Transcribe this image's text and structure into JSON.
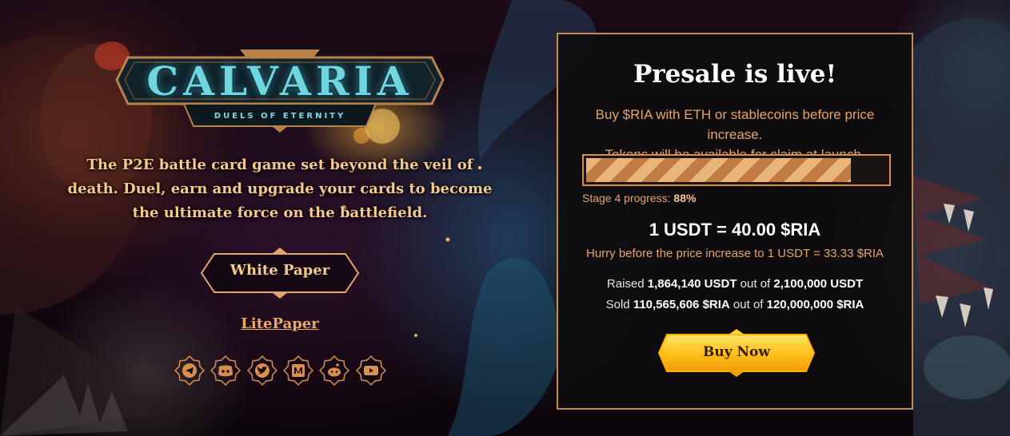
{
  "logo": {
    "title": "CALVARIA",
    "subtitle": "DUELS OF ETERNITY"
  },
  "hero": {
    "tagline": "The P2E battle card game set beyond the veil of death. Duel, earn and upgrade your cards to become the ultimate force on the battlefield.",
    "white_paper_label": "White Paper",
    "litepaper_label": "LitePaper"
  },
  "socials": [
    {
      "icon": "telegram-icon"
    },
    {
      "icon": "discord-icon"
    },
    {
      "icon": "twitter-icon"
    },
    {
      "icon": "medium-icon"
    },
    {
      "icon": "reddit-icon"
    },
    {
      "icon": "youtube-icon"
    }
  ],
  "presale": {
    "title": "Presale is live!",
    "desc_line1": "Buy $RIA with ETH or stablecoins before price increase.",
    "desc_line2": "Tokens will be available for claim at launch.",
    "stage_label": "Stage 4 progress:",
    "progress_value": "88%",
    "progress_fraction": 0.88,
    "rate": "1 USDT = 40.00 $RIA",
    "hurry": "Hurry before the price increase to 1 USDT = 33.33 $RIA",
    "raised_label": "Raised",
    "raised_value": "1,864,140 USDT",
    "raised_sep": "out of",
    "raised_total": "2,100,000 USDT",
    "sold_label": "Sold",
    "sold_value": "110,565,606 $RIA",
    "sold_sep": "out of",
    "sold_total": "120,000,000 $RIA",
    "buy_label": "Buy Now"
  },
  "colors": {
    "accent": "#c98a4e",
    "gold_text": "#f3c98e",
    "card_bg": "#0e0d0e",
    "logo_cyan": "#6fd6e0"
  }
}
